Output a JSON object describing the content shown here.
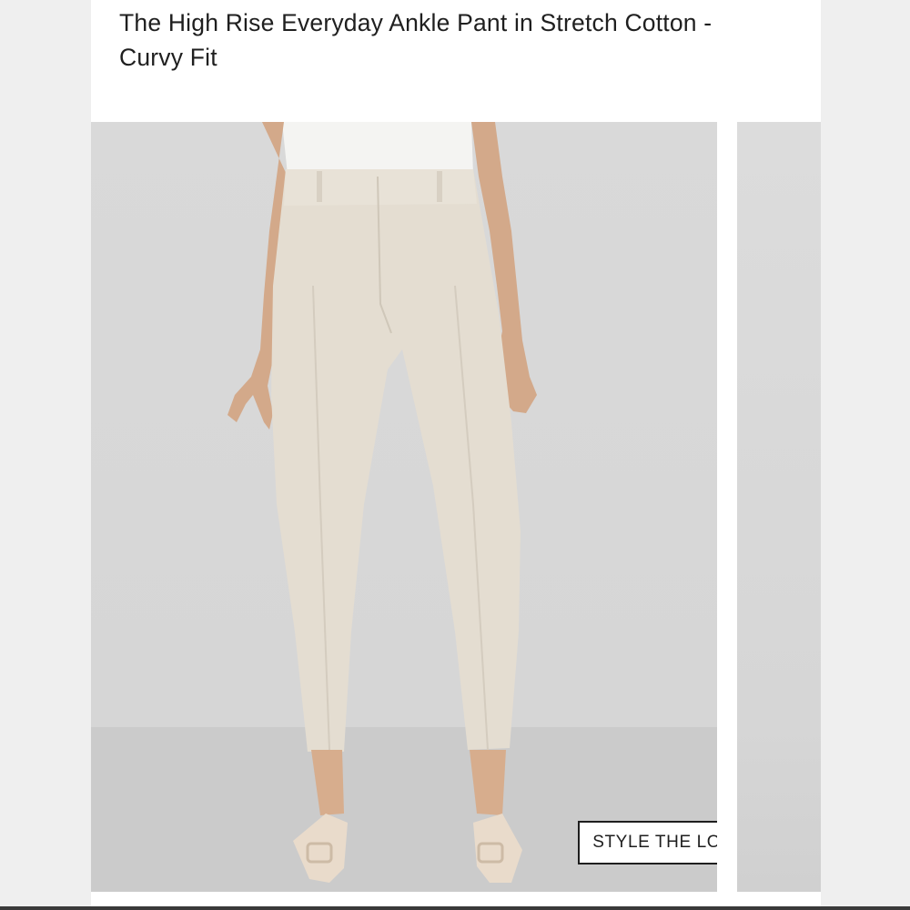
{
  "product": {
    "title_line1": "The High Rise Everyday Ankle Pant in Stretch Cotton -",
    "title_line2": "Curvy Fit"
  },
  "gallery": {
    "main_image_alt": "Model wearing high rise ankle pant in stone",
    "style_button_label": "STYLE THE LOOK"
  },
  "colors": {
    "pant": "#e4ddd1",
    "background": "#d8d8d8",
    "panel": "#ffffff",
    "button_border": "#1e1e1e"
  }
}
